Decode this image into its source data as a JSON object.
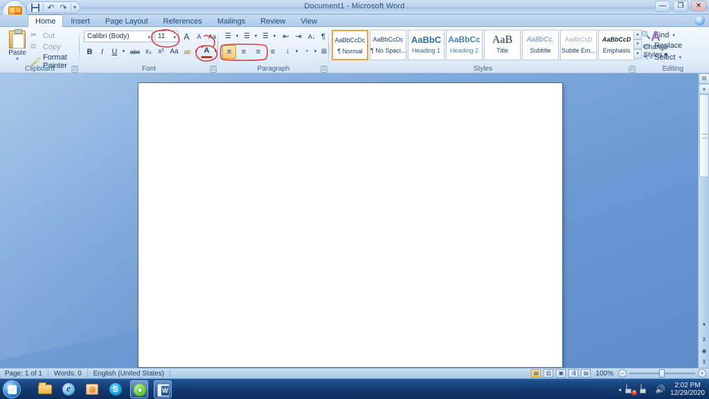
{
  "window": {
    "title": "Document1 - Microsoft Word",
    "minimize_label": "—",
    "restore_label": "❐",
    "close_label": "✕",
    "help_label": "?"
  },
  "quick_access": {
    "office_button": "office-button",
    "items": [
      {
        "name": "save",
        "label": "Save",
        "glyph": ""
      },
      {
        "name": "undo",
        "label": "Undo",
        "glyph": "↶"
      },
      {
        "name": "redo",
        "label": "Redo",
        "glyph": "↷"
      },
      {
        "name": "customize",
        "label": "Customize Quick Access Toolbar",
        "glyph": "▾"
      }
    ]
  },
  "ribbon": {
    "tabs": [
      {
        "label": "Home",
        "active": true
      },
      {
        "label": "Insert",
        "active": false
      },
      {
        "label": "Page Layout",
        "active": false
      },
      {
        "label": "References",
        "active": false
      },
      {
        "label": "Mailings",
        "active": false
      },
      {
        "label": "Review",
        "active": false
      },
      {
        "label": "View",
        "active": false
      }
    ],
    "groups": {
      "clipboard": {
        "label": "Clipboard",
        "paste_label": "Paste",
        "paste_caret": "▾",
        "items": [
          {
            "label": "Cut",
            "glyph": "✂",
            "enabled": false
          },
          {
            "label": "Copy",
            "glyph": "⧉",
            "enabled": false
          },
          {
            "label": "Format Painter",
            "glyph": "🖌",
            "enabled": true
          }
        ],
        "dialog_launcher": "◰"
      },
      "font": {
        "label": "Font",
        "font_name_value": "Calibri (Body)",
        "font_size_value": "11",
        "caret": "▾",
        "grow_font": "A",
        "shrink_font": "A",
        "clear_formatting": "Aa",
        "bold": "B",
        "italic": "I",
        "underline": "U",
        "strikethrough": "abc",
        "subscript": "x₂",
        "superscript": "x²",
        "change_case": "Aa",
        "highlight": "ab",
        "font_color": "A",
        "dialog_launcher": "◰"
      },
      "paragraph": {
        "label": "Paragraph",
        "bullets": "☰",
        "numbering": "☰",
        "multilevel": "☰",
        "decrease_indent": "⇤",
        "increase_indent": "⇥",
        "sort": "A↓",
        "show_marks": "¶",
        "align_left": "≡",
        "align_center": "≡",
        "align_right": "≡",
        "justify": "≡",
        "line_spacing": "↕",
        "shading": "◔",
        "borders": "⊞",
        "dialog_launcher": "◰"
      },
      "styles": {
        "label": "Styles",
        "gallery": [
          {
            "sample": "AaBbCcDc",
            "name": "¶ Normal",
            "selected": true
          },
          {
            "sample": "AaBbCcDc",
            "name": "¶ No Spaci...",
            "selected": false
          },
          {
            "sample": "AaBbC",
            "name": "Heading 1",
            "selected": false
          },
          {
            "sample": "AaBbCc",
            "name": "Heading 2",
            "selected": false
          },
          {
            "sample": "AaB",
            "name": "Title",
            "selected": false
          },
          {
            "sample": "AaBbCc.",
            "name": "Subtitle",
            "selected": false
          },
          {
            "sample": "AaBbCcD",
            "name": "Subtle Em...",
            "selected": false
          },
          {
            "sample": "AaBbCcD",
            "name": "Emphasis",
            "selected": false
          }
        ],
        "scroll_up": "▴",
        "scroll_down": "▾",
        "more": "▾",
        "change_styles_line1": "Change",
        "change_styles_line2": "Styles ▾",
        "change_styles_icon": "A",
        "dialog_launcher": "◰"
      },
      "editing": {
        "label": "Editing",
        "items": [
          {
            "label": "Find",
            "glyph": "🔍",
            "caret": "▾"
          },
          {
            "label": "Replace",
            "glyph": "ab",
            "caret": ""
          },
          {
            "label": "Select",
            "glyph": "↖",
            "caret": "▾"
          }
        ]
      }
    }
  },
  "document": {
    "page_background": "#ffffff"
  },
  "scrollbar": {
    "ruler_toggle": "▤",
    "up_arrow": "▴",
    "down_arrow": "▾",
    "prev_page": "⊼",
    "select_object": "◉",
    "next_page": "⊻"
  },
  "status_bar": {
    "page": "Page: 1 of 1",
    "words": "Words: 0",
    "language": "English (United States)",
    "zoom_level": "100%",
    "zoom_out": "−",
    "zoom_in": "+",
    "views": [
      {
        "name": "print-layout",
        "glyph": "▤",
        "active": true
      },
      {
        "name": "full-screen-reading",
        "glyph": "▥",
        "active": false
      },
      {
        "name": "web-layout",
        "glyph": "▣",
        "active": false
      },
      {
        "name": "outline",
        "glyph": "⇶",
        "active": false
      },
      {
        "name": "draft",
        "glyph": "▤",
        "active": false
      }
    ]
  },
  "taskbar": {
    "start_label": "Start",
    "items": [
      {
        "name": "windows-explorer",
        "label": "Windows Explorer"
      },
      {
        "name": "internet-explorer",
        "label": "Internet Explorer",
        "glyph": "e"
      },
      {
        "name": "windows-media-player",
        "label": "Windows Media Player"
      },
      {
        "name": "skype",
        "label": "Skype",
        "glyph": "S"
      },
      {
        "name": "disc-burner",
        "label": "Disc Burner"
      },
      {
        "name": "microsoft-word",
        "label": "Document1 - Microsoft Word"
      }
    ],
    "tray": {
      "show_hidden": "◂",
      "action_center": "Action Center",
      "network": "Network",
      "volume": "🔊",
      "time": "2:02 PM",
      "date": "12/29/2020"
    }
  },
  "annotations": {
    "color": "#e03a3a",
    "marks": [
      {
        "name": "font-size-circle",
        "target": "font size 11"
      },
      {
        "name": "font-color-circle",
        "target": "font color A"
      },
      {
        "name": "alignment-buttons-box",
        "target": "paragraph alignment buttons"
      }
    ]
  }
}
